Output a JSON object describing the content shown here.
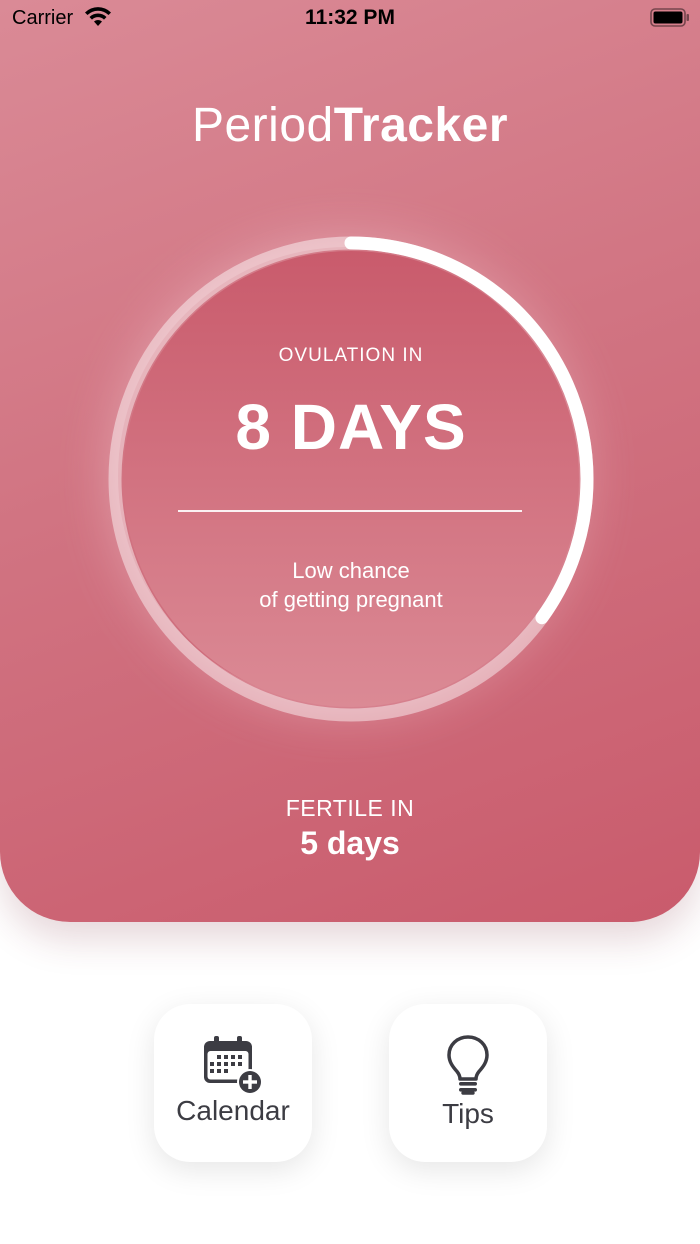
{
  "status_bar": {
    "carrier": "Carrier",
    "time": "11:32 PM"
  },
  "header": {
    "title_light": "Period",
    "title_bold": "Tracker"
  },
  "ovulation": {
    "label": "OVULATION IN",
    "value": "8 DAYS",
    "chance_line1": "Low chance",
    "chance_line2": "of getting pregnant",
    "ring_progress": 0.35
  },
  "fertile": {
    "label": "FERTILE IN",
    "value": "5 days"
  },
  "actions": {
    "calendar": {
      "label": "Calendar",
      "icon": "calendar-add-icon"
    },
    "tips": {
      "label": "Tips",
      "icon": "lightbulb-icon"
    }
  },
  "colors": {
    "hero_light": "#da8a96",
    "hero_mid": "#d17482",
    "hero_dark": "#c95b6c",
    "button_text": "#3c3c43",
    "icon": "#3c3c43"
  }
}
